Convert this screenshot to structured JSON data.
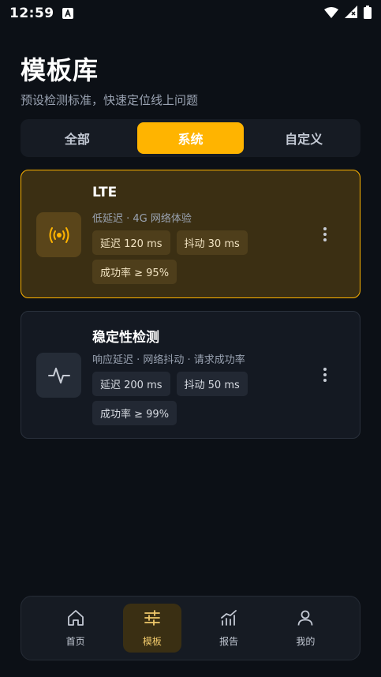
{
  "status_bar": {
    "time": "12:59",
    "icons": [
      "app-a-icon",
      "wifi-icon",
      "cellular-icon",
      "battery-icon"
    ]
  },
  "header": {
    "title": "模板库",
    "subtitle": "预设检测标准，快速定位线上问题"
  },
  "tabs": [
    {
      "label": "全部",
      "active": false
    },
    {
      "label": "系统",
      "active": true
    },
    {
      "label": "自定义",
      "active": false
    }
  ],
  "cards": [
    {
      "title": "LTE",
      "description": "低延迟 · 4G 网络体验",
      "icon": "antenna-signal-icon",
      "selected": true,
      "tags": [
        "延迟 120 ms",
        "抖动 30 ms",
        "成功率 ≥ 95%"
      ]
    },
    {
      "title": "稳定性检测",
      "description": "响应延迟 · 网络抖动 · 请求成功率",
      "icon": "pulse-wave-icon",
      "selected": false,
      "tags": [
        "延迟 200 ms",
        "抖动 50 ms",
        "成功率 ≥ 99%"
      ]
    }
  ],
  "bottom_nav": [
    {
      "label": "首页",
      "icon": "home-icon",
      "active": false
    },
    {
      "label": "模板",
      "icon": "sliders-icon",
      "active": true
    },
    {
      "label": "报告",
      "icon": "bar-chart-icon",
      "active": false
    },
    {
      "label": "我的",
      "icon": "user-icon",
      "active": false
    }
  ],
  "colors": {
    "background": "#0c1016",
    "accent": "#ffb400",
    "card": "#141922",
    "card_selected": "#3b2f13"
  }
}
